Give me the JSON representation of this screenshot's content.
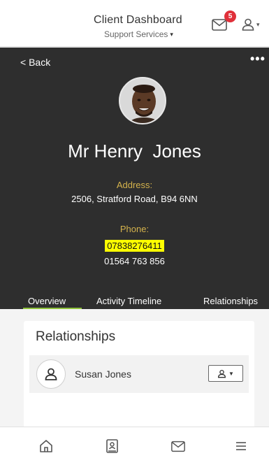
{
  "header": {
    "title": "Client Dashboard",
    "subtitle": "Support Services",
    "notification_count": "5",
    "icons": {
      "mail": "mail-icon",
      "user": "user-icon"
    }
  },
  "profile": {
    "back_label": "< Back",
    "more_label": "•••",
    "name": "Mr Henry  Jones",
    "address_label": "Address:",
    "address": "2506, Stratford Road, B94 6NN",
    "phone_label": "Phone:",
    "phone_primary": "07838276411",
    "phone_secondary": "01564 763 856"
  },
  "tabs": [
    {
      "label": "Overview",
      "active": true
    },
    {
      "label": "Activity Timeline",
      "active": false
    },
    {
      "label": "Relationships",
      "active": false
    }
  ],
  "relationships": {
    "title": "Relationships",
    "items": [
      {
        "name": "Susan Jones"
      }
    ]
  },
  "bottom_nav": [
    {
      "icon": "home-icon"
    },
    {
      "icon": "contact-book-icon"
    },
    {
      "icon": "mail-icon"
    },
    {
      "icon": "menu-icon"
    }
  ],
  "colors": {
    "accent_green": "#8fc23a",
    "gold_label": "#d4b24c",
    "badge_red": "#e0303a",
    "dark_panel": "#2e2e2e",
    "phone_highlight": "#ffff00"
  }
}
